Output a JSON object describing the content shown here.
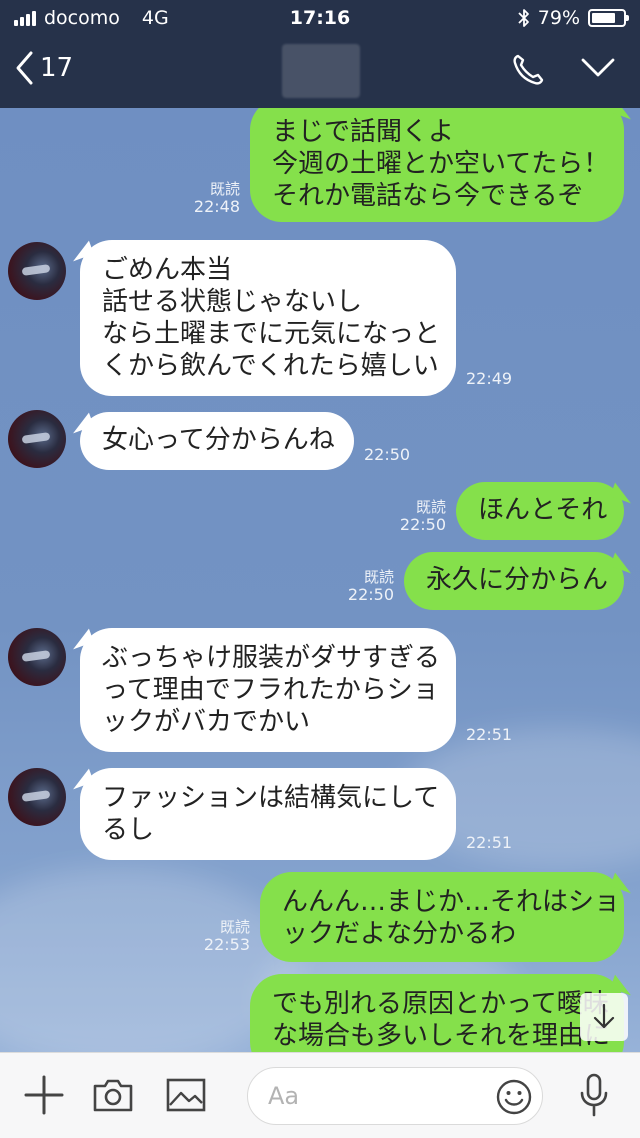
{
  "status_bar": {
    "carrier": "docomo",
    "network": "4G",
    "time": "17:16",
    "battery": "79%",
    "battery_level": 0.79
  },
  "header": {
    "back_count": "17"
  },
  "messages": [
    {
      "side": "out",
      "text": "まじで話聞くよ\n今週の土曜とか空いてたら！\nそれか電話なら今できるぞ",
      "read": "既読",
      "time": "22:48"
    },
    {
      "side": "in",
      "text": "ごめん本当\n話せる状態じゃないし\nなら土曜までに元気になっと\nくから飲んでくれたら嬉しい",
      "time": "22:49"
    },
    {
      "side": "in",
      "text": "女心って分からんね",
      "time": "22:50"
    },
    {
      "side": "out",
      "text": "ほんとそれ",
      "read": "既読",
      "time": "22:50"
    },
    {
      "side": "out",
      "text": "永久に分からん",
      "read": "既読",
      "time": "22:50"
    },
    {
      "side": "in",
      "text": "ぶっちゃけ服装がダサすぎる\nって理由でフラれたからショ\nックがバカでかい",
      "time": "22:51"
    },
    {
      "side": "in",
      "text": "ファッションは結構気にして\nるし",
      "time": "22:51"
    },
    {
      "side": "out",
      "text": "んんん…まじか…それはショ\nックだよな分かるわ",
      "read": "既読",
      "time": "22:53"
    },
    {
      "side": "out",
      "text": "でも別れる原因とかって曖昧\nな場合も多いしそれを理由に"
    }
  ],
  "input": {
    "placeholder": "Aa"
  },
  "colors": {
    "header_bg": "#26324a",
    "outgoing_bubble": "#85e04b",
    "incoming_bubble": "#ffffff",
    "chat_bg": "#7190c0"
  }
}
